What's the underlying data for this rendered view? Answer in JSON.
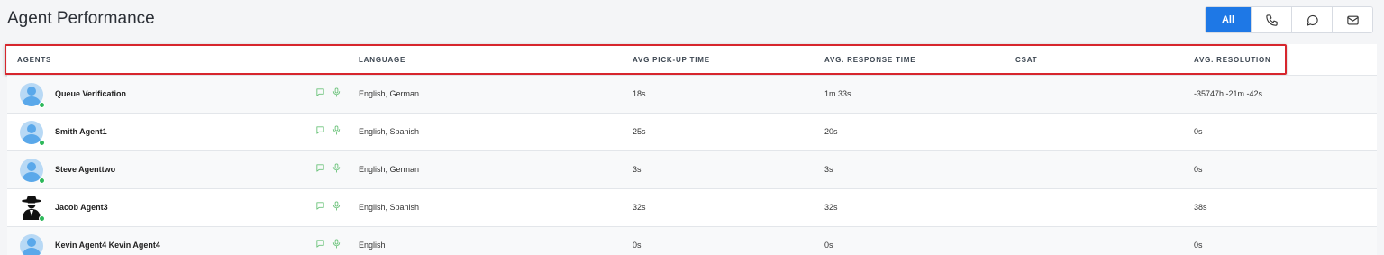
{
  "page": {
    "title": "Agent Performance"
  },
  "filters": {
    "all_label": "All",
    "items": [
      {
        "icon": "phone-icon"
      },
      {
        "icon": "chat-bubble-icon"
      },
      {
        "icon": "mail-icon"
      }
    ]
  },
  "colors": {
    "accent": "#1e78e6",
    "online": "#2db85a",
    "channel_icon": "#6cc37b",
    "highlight": "#d7262d"
  },
  "table": {
    "headers": {
      "agents": "AGENTS",
      "language": "LANGUAGE",
      "pickup": "AVG PICK-UP TIME",
      "response": "AVG. RESPONSE TIME",
      "csat": "CSAT",
      "resolution": "AVG. RESOLUTION"
    },
    "rows": [
      {
        "name": "Queue Verification",
        "language": "English, German",
        "pickup": "18s",
        "response": "1m 33s",
        "csat": "",
        "resolution": "-35747h -21m -42s"
      },
      {
        "name": "Smith Agent1",
        "language": "English, Spanish",
        "pickup": "25s",
        "response": "20s",
        "csat": "",
        "resolution": "0s"
      },
      {
        "name": "Steve Agenttwo",
        "language": "English, German",
        "pickup": "3s",
        "response": "3s",
        "csat": "",
        "resolution": "0s"
      },
      {
        "name": "Jacob Agent3",
        "language": "English, Spanish",
        "pickup": "32s",
        "response": "32s",
        "csat": "",
        "resolution": "38s"
      },
      {
        "name": "Kevin Agent4 Kevin Agent4",
        "language": "English",
        "pickup": "0s",
        "response": "0s",
        "csat": "",
        "resolution": "0s"
      }
    ]
  }
}
